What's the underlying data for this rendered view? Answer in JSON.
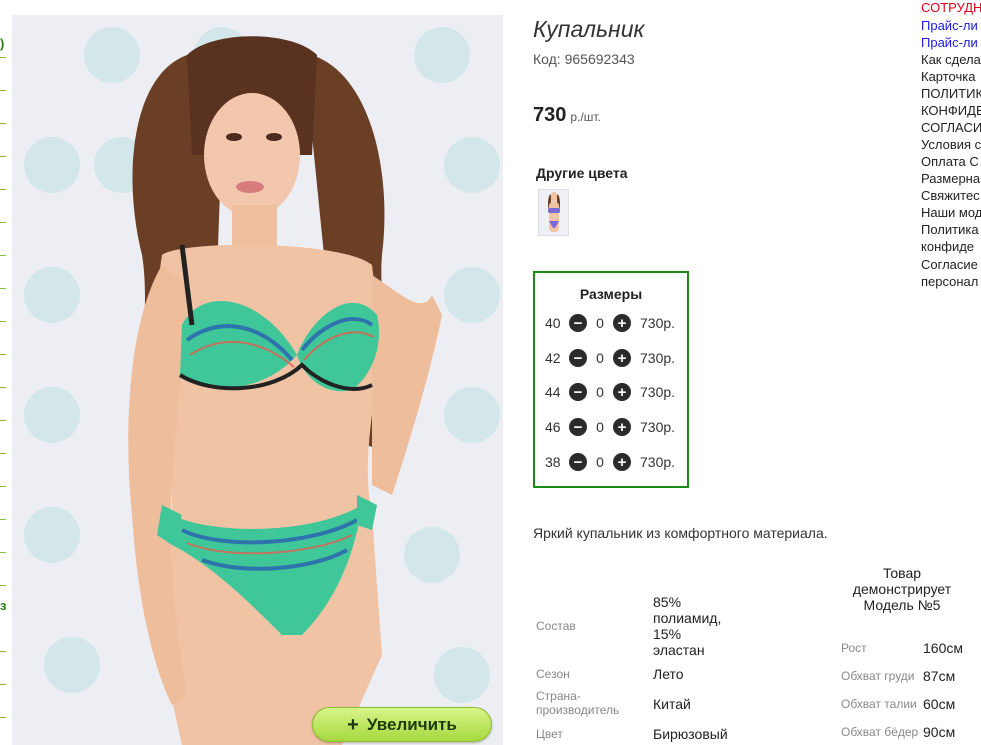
{
  "left_nav": {
    "fragments": [
      ")",
      "з"
    ]
  },
  "product": {
    "title": "Купальник",
    "code_label": "Код:",
    "code_value": "965692343",
    "price": "730",
    "price_unit": "р./шт.",
    "other_colors_label": "Другие цвета",
    "zoom_button_label": "Увеличить",
    "zoom_button_icon": "+"
  },
  "sizes": {
    "header": "Размеры",
    "rows": [
      {
        "size": "40",
        "qty": "0",
        "price": "730р."
      },
      {
        "size": "42",
        "qty": "0",
        "price": "730р."
      },
      {
        "size": "44",
        "qty": "0",
        "price": "730р."
      },
      {
        "size": "46",
        "qty": "0",
        "price": "730р."
      },
      {
        "size": "38",
        "qty": "0",
        "price": "730р."
      }
    ],
    "minus_icon": "minus-circle-icon",
    "plus_icon": "plus-circle-icon"
  },
  "description": "Яркий купальник из комфортного материала.",
  "specs": [
    {
      "label": "Состав",
      "value": "85% полиамид, 15% эластан"
    },
    {
      "label": "Сезон",
      "value": "Лето"
    },
    {
      "label": "Страна-производитель",
      "value": "Китай"
    },
    {
      "label": "Цвет",
      "value": "Бирюзовый"
    }
  ],
  "model": {
    "header": "Товар демонстрирует Модель №5",
    "rows": [
      {
        "label": "Рост",
        "value": "160см"
      },
      {
        "label": "Обхват груди",
        "value": "87см"
      },
      {
        "label": "Обхват талии",
        "value": "60см"
      },
      {
        "label": "Обхват бёдер",
        "value": "90см"
      }
    ]
  },
  "right_links": [
    "СОТРУДН",
    "Прайс-ли",
    "Прайс-ли",
    "Как сдела",
    "Карточка",
    "ПОЛИТИК",
    "КОНФИДЕ",
    "СОГЛАСИ",
    "Условия с",
    "Оплата С",
    "Размерна",
    "Свяжитес",
    "Наши мод",
    "Политика",
    "конфиде",
    "Согласие",
    "персонал"
  ],
  "colors": {
    "border_green": "#1a8a1a",
    "zoom_button_green": "#a6d83e",
    "link_red": "#e0001a",
    "link_blue": "#1a1adf"
  }
}
